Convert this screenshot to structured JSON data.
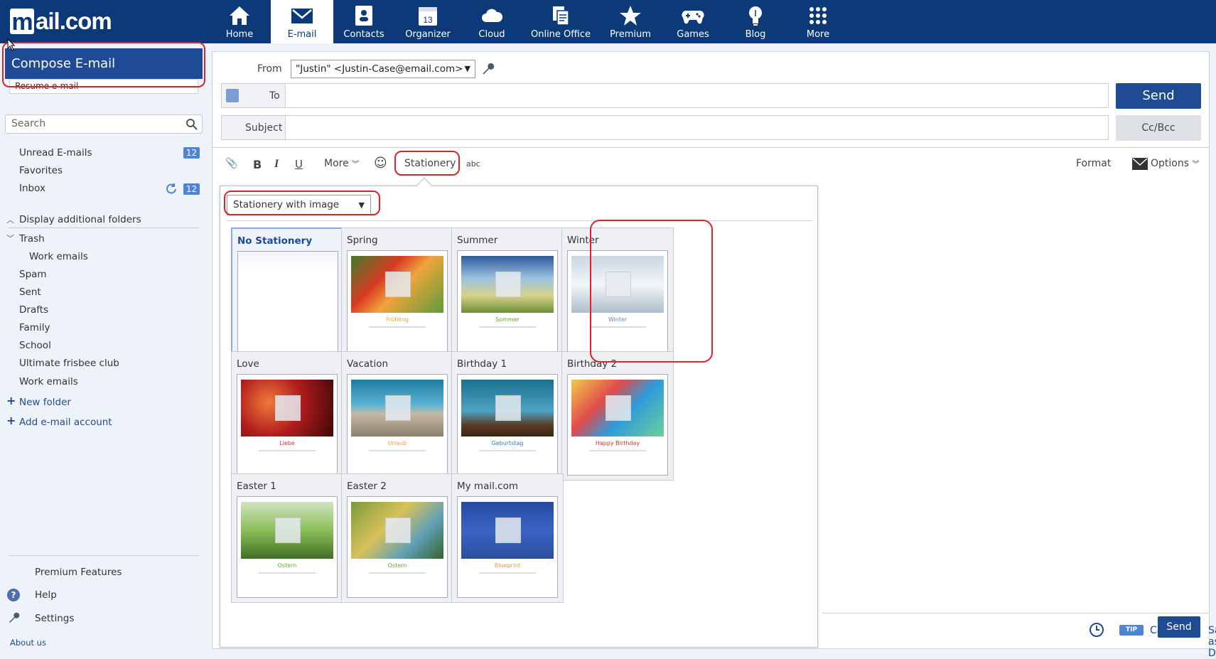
{
  "brand": {
    "logo": "mail.com",
    "logo_letter": "m",
    "primary_color": "#0c3a79",
    "accent_color": "#1f4a94",
    "highlight_color": "#e0202a"
  },
  "nav": [
    {
      "label": "Home",
      "icon": "home-icon"
    },
    {
      "label": "E-mail",
      "icon": "envelope-icon",
      "active": true
    },
    {
      "label": "Contacts",
      "icon": "contacts-icon"
    },
    {
      "label": "Organizer",
      "icon": "calendar-icon",
      "badge": "13"
    },
    {
      "label": "Cloud",
      "icon": "cloud-icon"
    },
    {
      "label": "Online Office",
      "icon": "documents-icon"
    },
    {
      "label": "Premium",
      "icon": "star-icon"
    },
    {
      "label": "Games",
      "icon": "gamepad-icon"
    },
    {
      "label": "Blog",
      "icon": "lightbulb-icon"
    },
    {
      "label": "More",
      "icon": "grid-icon"
    }
  ],
  "sidebar": {
    "compose": "Compose E-mail",
    "resume": "Resume e-mail",
    "search_placeholder": "Search",
    "folders": [
      {
        "label": "Unread E-mails",
        "count": "12"
      },
      {
        "label": "Favorites"
      },
      {
        "label": "Inbox",
        "count": "12"
      }
    ],
    "display_additional": "Display additional folders",
    "trash": "Trash",
    "trash_sub": "Work emails",
    "more_folders": [
      "Spam",
      "Sent",
      "Drafts",
      "Family",
      "School",
      "Ultimate frisbee club",
      "Work emails"
    ],
    "new_folder": "New folder",
    "add_account": "Add e-mail account",
    "bottom": [
      "Premium Features",
      "Help",
      "Settings"
    ],
    "about": "About us"
  },
  "compose": {
    "from_label": "From",
    "from_value": "\"Justin\" <Justin-Case@email.com>",
    "to_label": "To",
    "subject_label": "Subject",
    "send": "Send",
    "ccbcc": "Cc/Bcc"
  },
  "toolbar": {
    "more": "More",
    "stationery": "Stationery",
    "format": "Format",
    "options": "Options"
  },
  "stationery": {
    "selected_type": "Stationery with image",
    "items": [
      {
        "title": "No Stationery",
        "selected": true
      },
      {
        "title": "Spring",
        "caption": "Frühling",
        "caption_color": "#e8a23a"
      },
      {
        "title": "Summer",
        "caption": "Sommer",
        "caption_color": "#6a9f3a"
      },
      {
        "title": "Winter",
        "caption": "Winter",
        "caption_color": "#6a8aa0"
      },
      {
        "title": "Love",
        "caption": "Liebe",
        "caption_color": "#d3302a"
      },
      {
        "title": "Vacation",
        "caption": "Urlaub",
        "caption_color": "#e8a23a"
      },
      {
        "title": "Birthday 1",
        "caption": "Geburtstag",
        "caption_color": "#2f7fb0"
      },
      {
        "title": "Birthday 2",
        "caption": "Happy Birthday",
        "caption_color": "#d3302a"
      },
      {
        "title": "Easter 1",
        "caption": "Ostern",
        "caption_color": "#6a9f3a"
      },
      {
        "title": "Easter 2",
        "caption": "Ostern",
        "caption_color": "#6a9f3a"
      },
      {
        "title": "My mail.com",
        "caption": "Blueprint",
        "caption_color": "#e8a23a"
      }
    ]
  },
  "footer": {
    "cancel": "Cancel",
    "save_draft": "Save as Draft",
    "tip": "TIP",
    "send": "Send"
  }
}
